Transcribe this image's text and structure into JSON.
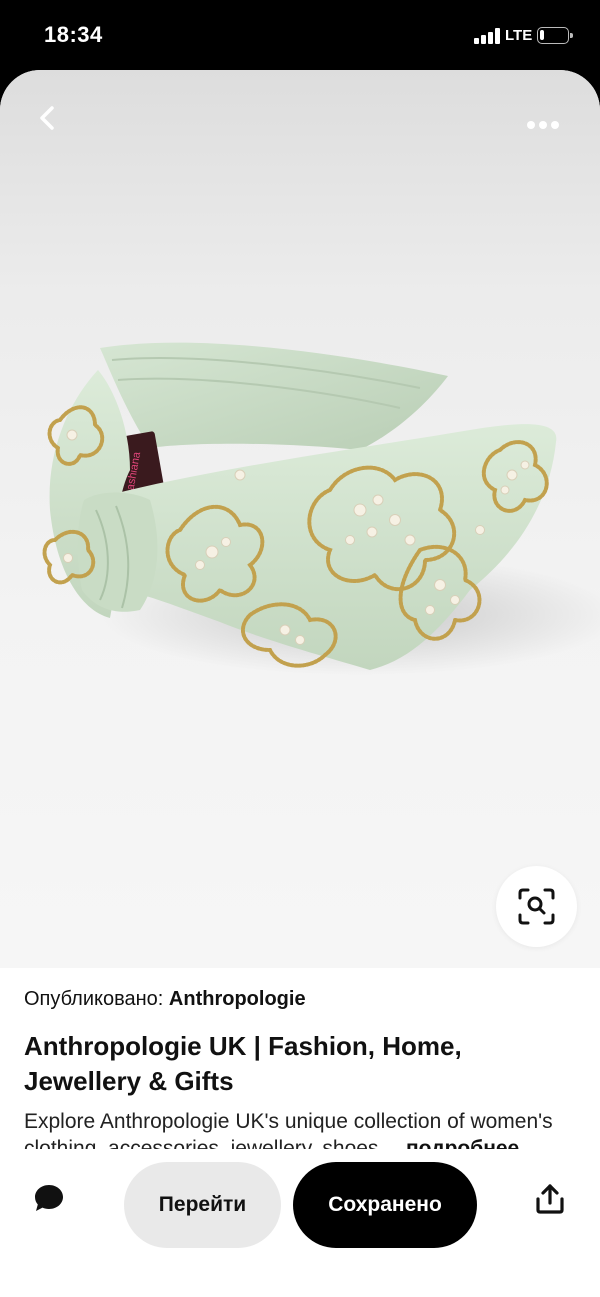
{
  "status_bar": {
    "time": "18:34",
    "network": "LTE",
    "battery_level": 0.15
  },
  "pin": {
    "image_alt": "Embellished mint headband",
    "brand_label_on_product": "ashiana",
    "published_label": "Опубликовано:",
    "publisher": "Anthropologie",
    "title": "Anthropologie UK | Fashion, Home, Jewellery & Gifts",
    "description": "Explore Anthropologie UK's unique collection of women's clothing, accessories, jewellery, shoes and home",
    "more_link": "подробнее"
  },
  "toolbar": {
    "back_icon": "chevron-left-icon",
    "more_icon": "more-horizontal-icon",
    "lens_icon": "visual-search-icon"
  },
  "actions": {
    "comment_icon": "comment-icon",
    "goto_label": "Перейти",
    "saved_label": "Сохранено",
    "share_icon": "share-icon"
  },
  "colors": {
    "headband": "#cfe0cc",
    "beads": "#c2a14e",
    "saved_button": "#000000",
    "goto_button": "#e9e9e9"
  }
}
